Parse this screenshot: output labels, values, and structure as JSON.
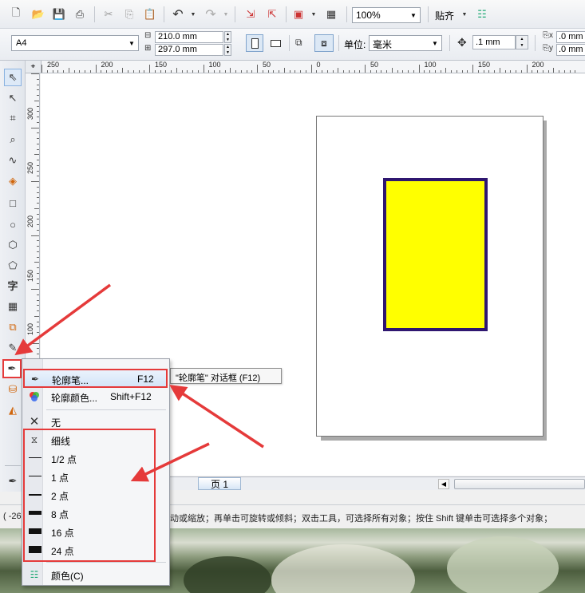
{
  "toolbar": {
    "zoom_value": "100%",
    "snap_label": "贴齐"
  },
  "property_bar": {
    "paper_size": "A4",
    "width_value": "210.0 mm",
    "height_value": "297.0 mm",
    "unit_label": "单位:",
    "unit_value": "毫米",
    "nudge_value": ".1 mm",
    "dup_x_value": ".0 mm",
    "dup_y_value": ".0 mm"
  },
  "rulers": {
    "horizontal": [
      "250",
      "200",
      "150",
      "100",
      "50",
      "0",
      "50",
      "100",
      "150",
      "200"
    ],
    "vertical": [
      "300",
      "250",
      "200",
      "150",
      "100"
    ]
  },
  "toolbox": {
    "tools": [
      "pick-tool",
      "shape-tool",
      "crop-tool",
      "zoom-tool",
      "freehand-tool",
      "smart-fill-tool",
      "rectangle-tool",
      "ellipse-tool",
      "polygon-tool",
      "basic-shapes-tool",
      "text-tool",
      "table-tool",
      "interactive-tool",
      "eyedropper-tool",
      "outline-pen-tool",
      "fill-tool",
      "interactive-fill-tool"
    ]
  },
  "context_menu": {
    "items": [
      {
        "label": "轮廓笔...",
        "shortcut": "F12",
        "icon": "pen-nib-icon"
      },
      {
        "label": "轮廓颜色...",
        "shortcut": "Shift+F12",
        "icon": "color-wheel-icon"
      },
      {
        "label": "无",
        "icon": "x-icon"
      },
      {
        "label": "细线",
        "icon": "hairline-icon"
      },
      {
        "label": "1/2 点",
        "thickness": 0.5
      },
      {
        "label": "1 点",
        "thickness": 1
      },
      {
        "label": "2 点",
        "thickness": 2
      },
      {
        "label": "8 点",
        "thickness": 8
      },
      {
        "label": "16 点",
        "thickness": 16
      },
      {
        "label": "24 点",
        "thickness": 24
      },
      {
        "label": "颜色(C)",
        "icon": "color-palette-icon"
      }
    ]
  },
  "tooltip": {
    "text": "\"轮廓笔\" 对话框 (F12)"
  },
  "page_tabs": {
    "tab_label": "页 1"
  },
  "status_bar": {
    "left_text": "( -26",
    "hint_text": "动或缩放；再单击可旋转或倾斜；双击工具，可选择所有对象；按住 Shift 键单击可选择多个对象；"
  },
  "drawing": {
    "fill_color": "#ffff00",
    "outline_color": "#2f1770"
  },
  "annotation_color": "#e53a3a"
}
